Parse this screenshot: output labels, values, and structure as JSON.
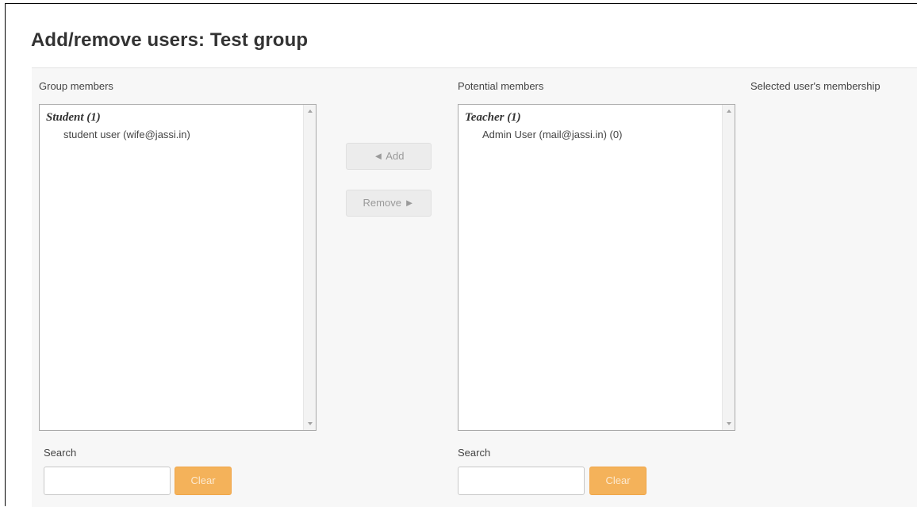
{
  "page": {
    "title": "Add/remove users: Test group"
  },
  "group_members": {
    "label": "Group members",
    "groups": [
      {
        "name": "Student (1)",
        "options": [
          "student user (wife@jassi.in)"
        ]
      }
    ]
  },
  "potential_members": {
    "label": "Potential members",
    "groups": [
      {
        "name": "Teacher (1)",
        "options": [
          "Admin User (mail@jassi.in) (0)"
        ]
      }
    ]
  },
  "selected_membership": {
    "label": "Selected user's membership"
  },
  "actions": {
    "add_label": "◄ Add",
    "remove_label": "Remove ►"
  },
  "search_left": {
    "label": "Search",
    "value": "",
    "clear_label": "Clear"
  },
  "search_right": {
    "label": "Search",
    "value": "",
    "clear_label": "Clear"
  },
  "colors": {
    "clear_button": "#f4b25a",
    "disabled_button": "#ececec"
  }
}
